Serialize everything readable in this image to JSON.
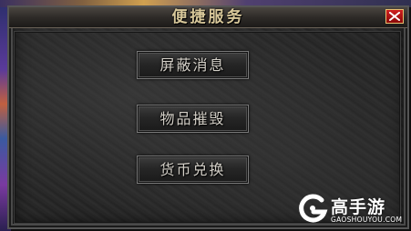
{
  "dialog": {
    "title": "便捷服务",
    "close_icon": "close-x-icon"
  },
  "buttons": [
    {
      "label": "屏蔽消息"
    },
    {
      "label": "物品摧毁"
    },
    {
      "label": "货币兑换"
    }
  ],
  "watermark": {
    "brand": "高手游",
    "domain": "GAOSHOUYOU.COM"
  },
  "colors": {
    "title_text": "#d8c89a",
    "close_button": "#c01010",
    "button_text": "#d4d0c8"
  }
}
